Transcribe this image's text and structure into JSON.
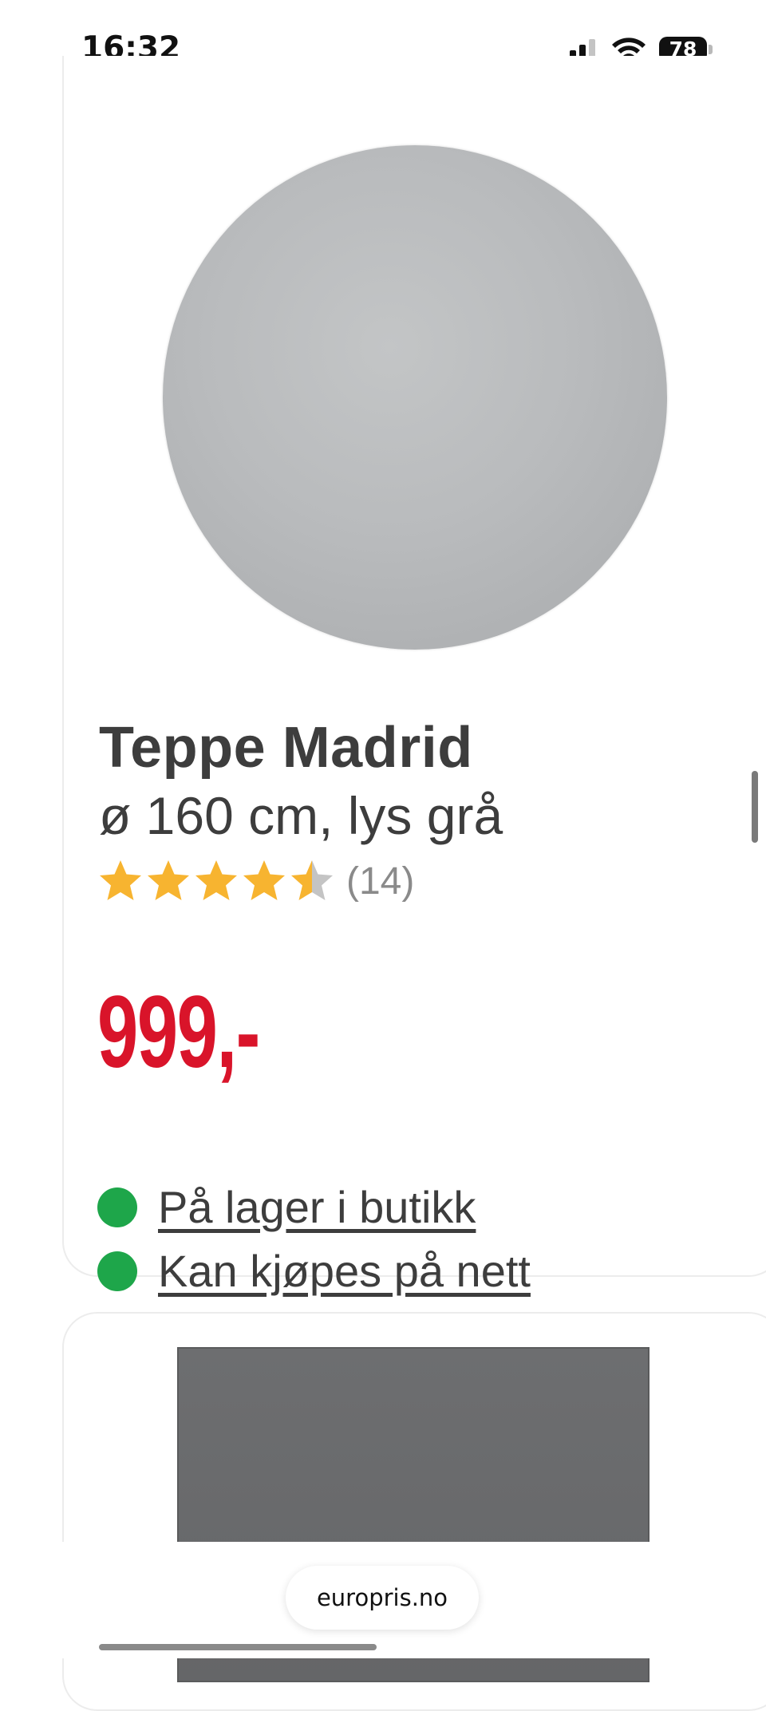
{
  "status_bar": {
    "time": "16:32",
    "battery_level": "78",
    "icons": [
      "cellular-signal-icon",
      "wifi-icon",
      "battery-icon"
    ]
  },
  "product_1": {
    "title": "Teppe Madrid",
    "subtitle": "ø 160 cm, lys grå",
    "rating_value": 4.5,
    "rating_max": 5,
    "review_count": "(14)",
    "price": "999,-",
    "availability": [
      {
        "label": "På lager i butikk",
        "status_color": "#1ea64a"
      },
      {
        "label": "Kan kjøpes på nett",
        "status_color": "#1ea64a"
      }
    ]
  },
  "browser": {
    "url": "europris.no"
  },
  "colors": {
    "price": "#d9142a",
    "star_filled": "#f7b430",
    "star_empty": "#c4c4c4",
    "stock_green": "#1ea64a"
  }
}
